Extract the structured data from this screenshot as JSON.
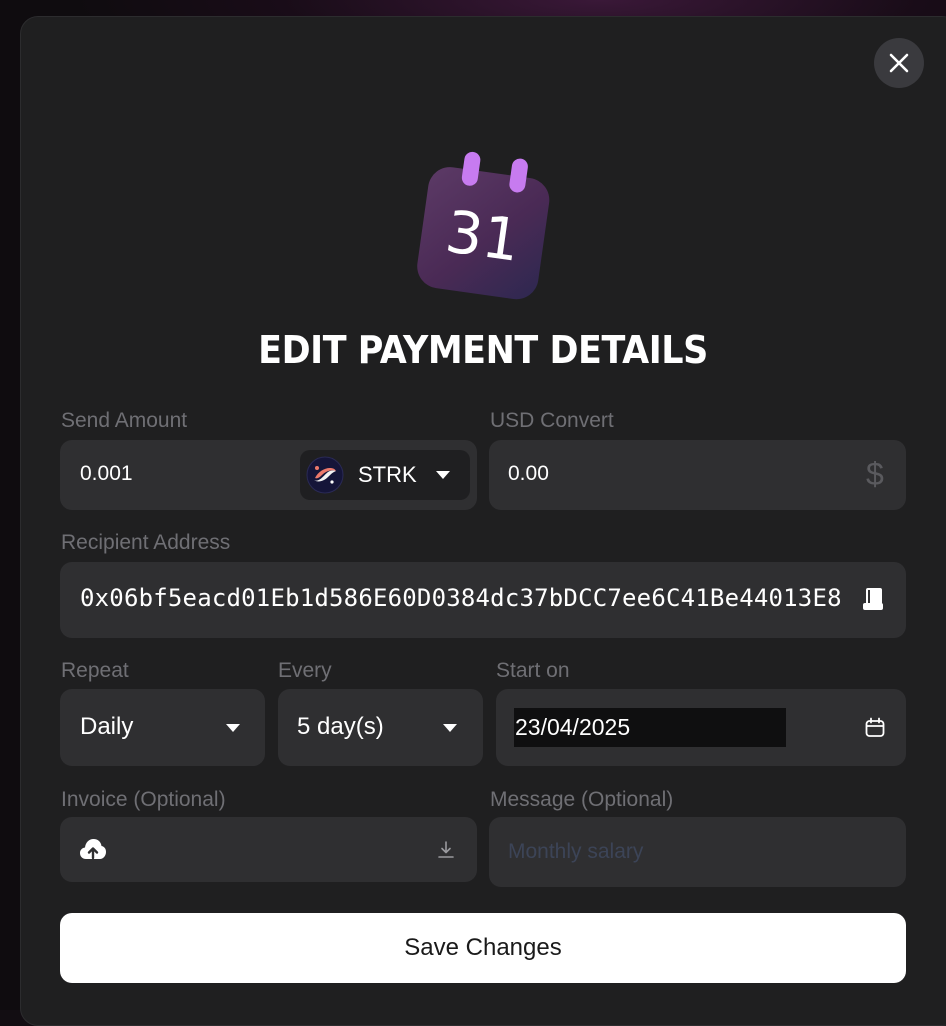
{
  "modal": {
    "title": "EDIT PAYMENT DETAILS",
    "calendar_day": "31",
    "close_icon": "close-icon"
  },
  "send_amount": {
    "label": "Send Amount",
    "value": "0.001",
    "token": "STRK",
    "token_icon": "starknet-token-icon"
  },
  "usd_convert": {
    "label": "USD Convert",
    "value": "0.00",
    "icon": "dollar-icon"
  },
  "recipient": {
    "label": "Recipient Address",
    "value": "0x06bf5eacd01Eb1d586E60D0384dc37bDCC7ee6C41Be44013E8",
    "icon": "address-book-icon"
  },
  "repeat": {
    "label": "Repeat",
    "value": "Daily"
  },
  "every": {
    "label": "Every",
    "value": "5 day(s)"
  },
  "start_on": {
    "label": "Start on",
    "value": "23/04/2025",
    "icon": "calendar-icon"
  },
  "invoice": {
    "label": "Invoice (Optional)",
    "upload_icon": "cloud-upload-icon",
    "download_icon": "download-icon"
  },
  "message": {
    "label": "Message (Optional)",
    "placeholder": "Monthly salary"
  },
  "save_button": {
    "label": "Save Changes"
  },
  "colors": {
    "modal_bg": "#1f1f20",
    "field_bg": "#2f2f31",
    "label": "#6f6f74",
    "accent_purple": "#c77bf0"
  }
}
